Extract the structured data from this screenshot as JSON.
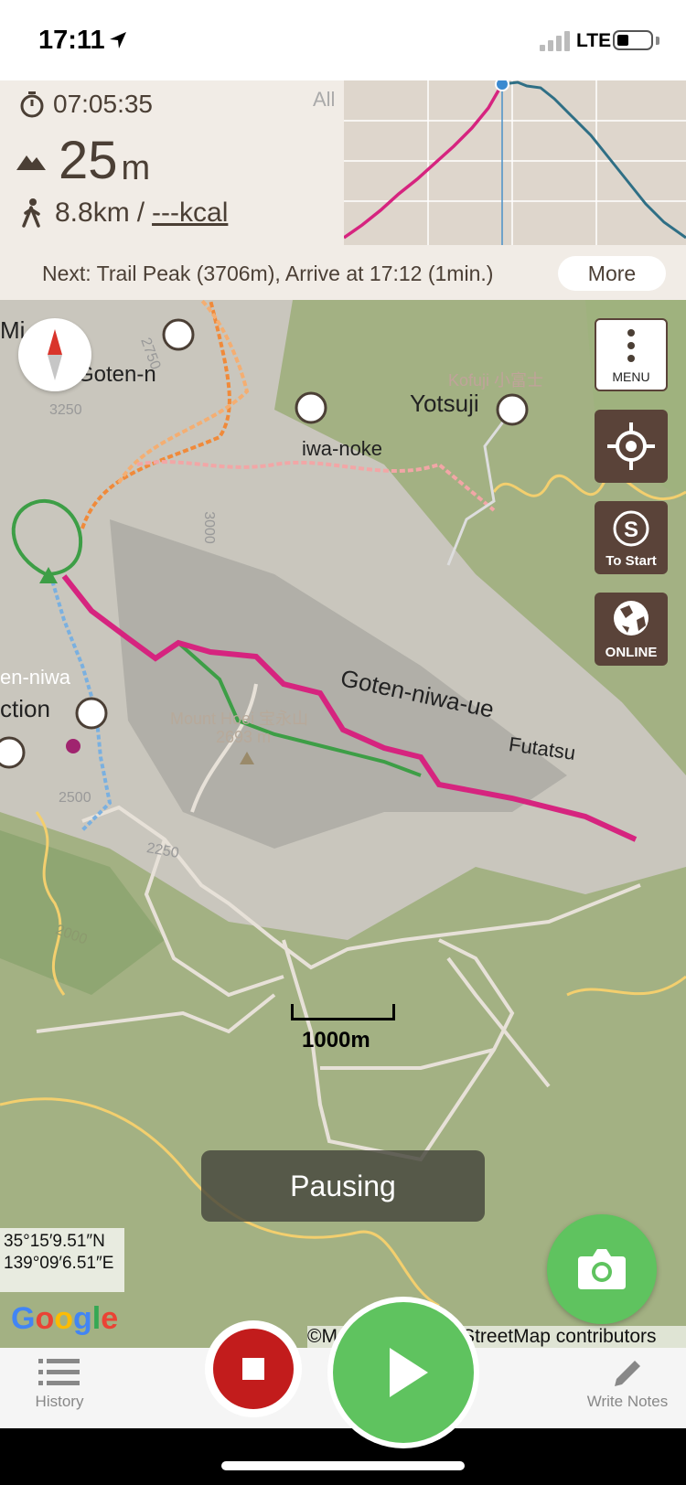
{
  "status_bar": {
    "time": "17:11",
    "network": "LTE"
  },
  "summary": {
    "elapsed": "07:05:35",
    "elevation_value": "25",
    "elevation_unit": "m",
    "distance": "8.8km",
    "separator": "/",
    "calories": "---kcal",
    "profile_range_label": "All"
  },
  "next_bar": {
    "text": "Next: Trail Peak (3706m), Arrive at 17:12 (1min.)",
    "more_label": "More"
  },
  "map": {
    "controls": {
      "menu_label": "MENU",
      "to_start_label": "To Start",
      "online_label": "ONLINE"
    },
    "labels": {
      "mi": "Mi",
      "goten_n": "Goten-n",
      "yotsuji": "Yotsuji",
      "kofuji": "Kofuji 小富士",
      "iwa_noke": "iwa-noke",
      "goten_niwa_ue": "Goten-niwa-ue",
      "futatsu": "Futatsu",
      "ction": "ction",
      "en_niwa": "en-niwa",
      "mount_hoei": "Mount Hoei 宝永山",
      "hoei_elev": "2693 m",
      "contour_3250": "3250",
      "contour_2750": "2750",
      "contour_3000": "3000",
      "contour_2500": "2500",
      "contour_2250": "2250",
      "contour_2000": "2000"
    },
    "scale_label": "1000m",
    "pause_label": "Pausing",
    "coords_lat": "35°15′9.51″N",
    "coords_lon": "139°09′6.51″E",
    "google_logo": "Google",
    "attribution": "©MapTiler ©OpenStreetMap contributors",
    "colors": {
      "track_magenta": "#d6247f",
      "route_green": "#3d9e46",
      "trail_orange": "#f08a3a",
      "trail_pink": "#f2a6a6",
      "trail_blue": "#7ab0e0",
      "road_yellow": "#f3cf6e"
    }
  },
  "toolbar": {
    "history_label": "History",
    "write_notes_label": "Write Notes"
  }
}
